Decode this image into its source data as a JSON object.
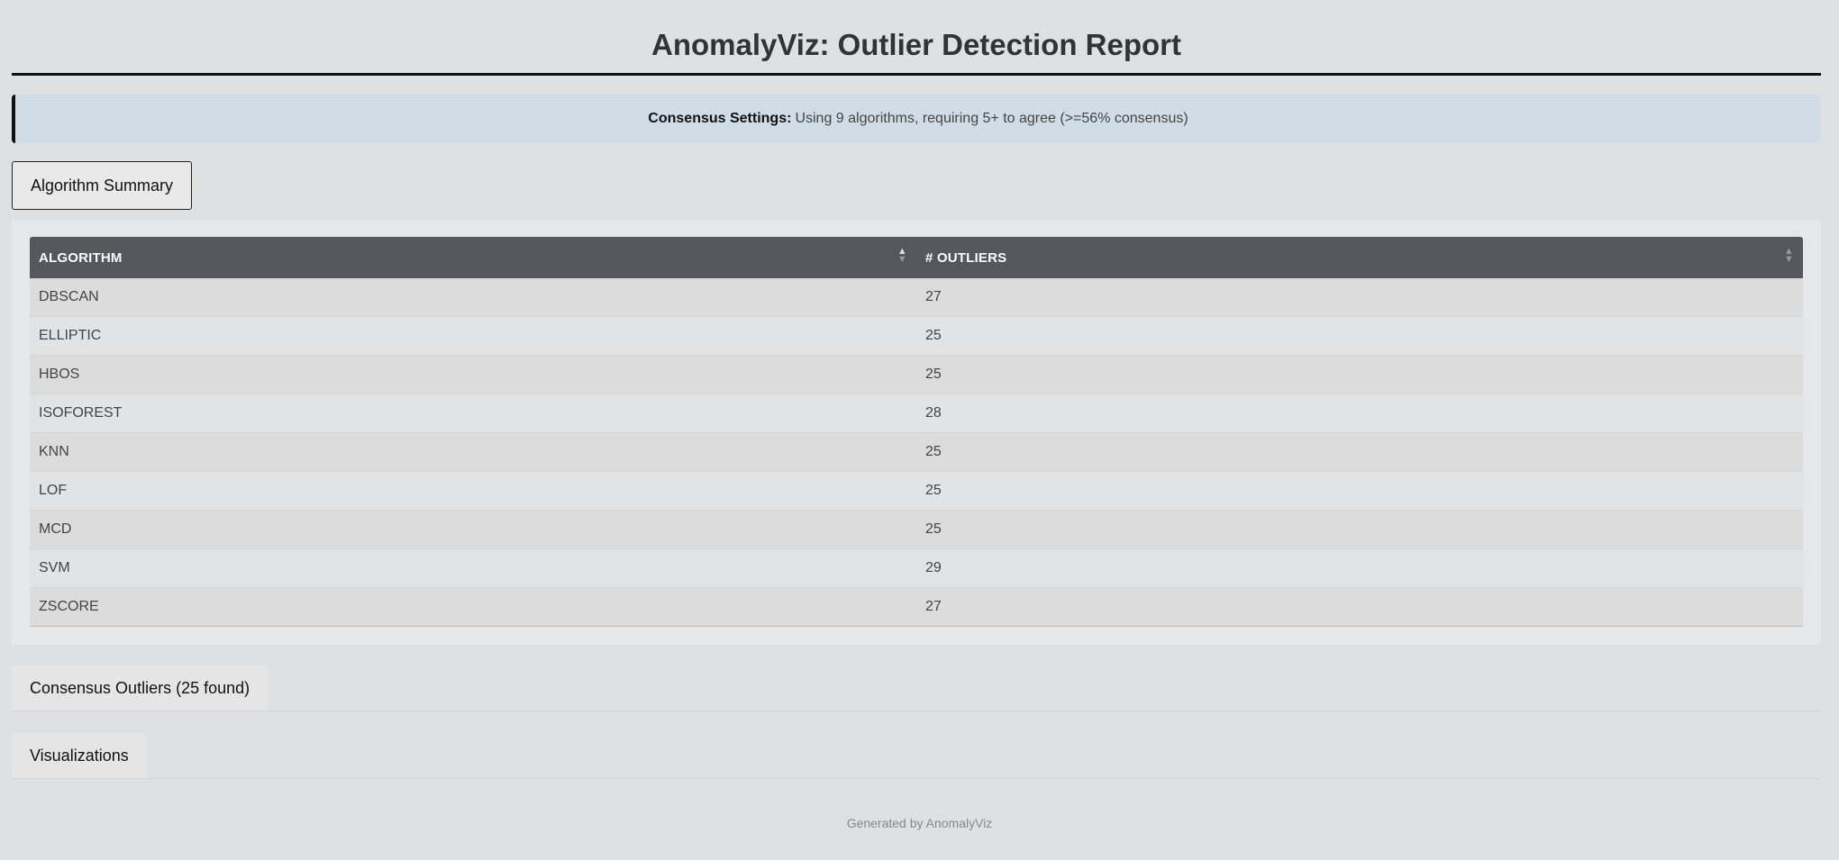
{
  "header": {
    "title": "AnomalyViz: Outlier Detection Report"
  },
  "info": {
    "label": "Consensus Settings:",
    "text": "Using 9 algorithms, requiring 5+ to agree (>=56% consensus)"
  },
  "sections": {
    "summary_label": "Algorithm Summary",
    "consensus_label": "Consensus Outliers (25 found)",
    "viz_label": "Visualizations"
  },
  "table": {
    "columns": [
      "ALGORITHM",
      "# OUTLIERS"
    ],
    "rows": [
      {
        "algorithm": "DBSCAN",
        "outliers": "27"
      },
      {
        "algorithm": "ELLIPTIC",
        "outliers": "25"
      },
      {
        "algorithm": "HBOS",
        "outliers": "25"
      },
      {
        "algorithm": "ISOFOREST",
        "outliers": "28"
      },
      {
        "algorithm": "KNN",
        "outliers": "25"
      },
      {
        "algorithm": "LOF",
        "outliers": "25"
      },
      {
        "algorithm": "MCD",
        "outliers": "25"
      },
      {
        "algorithm": "SVM",
        "outliers": "29"
      },
      {
        "algorithm": "ZSCORE",
        "outliers": "27"
      }
    ]
  },
  "icons": {
    "sort_active": "sort-ascending-icon",
    "sort_inactive": "sort-icon"
  },
  "footer": {
    "text": "Generated by AnomalyViz"
  },
  "colors": {
    "background": "#dfe0e2",
    "header_row": "#56575c",
    "info_box": "#d0dde6"
  }
}
